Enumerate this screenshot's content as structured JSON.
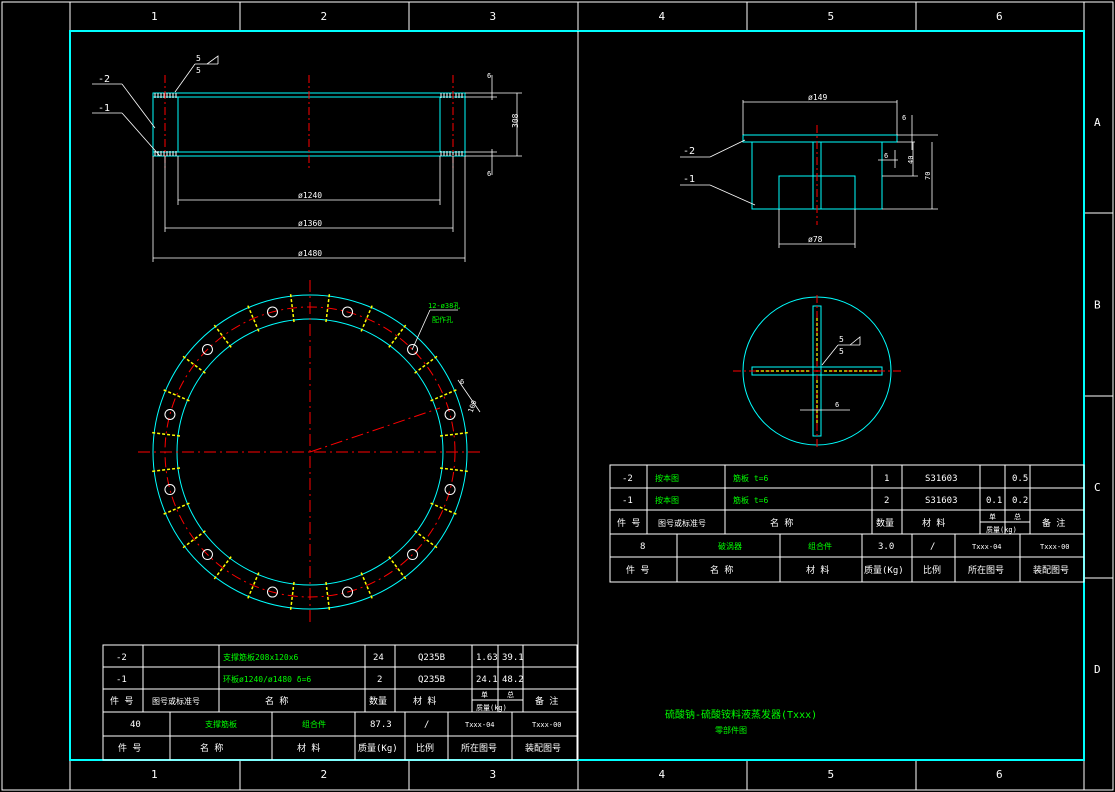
{
  "frame": {
    "col_labels": [
      "1",
      "2",
      "3",
      "4",
      "5",
      "6"
    ],
    "row_labels": [
      "A",
      "B",
      "C",
      "D"
    ]
  },
  "drawing_left": {
    "part_marks": [
      "-2",
      "-1"
    ],
    "weld_symbol": [
      "5",
      "5"
    ],
    "dims": {
      "d1240": "ø1240",
      "d1360": "ø1360",
      "d1480": "ø1480",
      "h308": "308",
      "t_top": "6",
      "t_bot": "6"
    },
    "hole_note": [
      "12-ø38孔",
      "配作孔"
    ],
    "rib_dims": [
      "6",
      "100"
    ]
  },
  "drawing_right": {
    "part_marks": [
      "-2",
      "-1"
    ],
    "dims": {
      "d149": "ø149",
      "d78": "ø78",
      "t6": "6",
      "h40": "40",
      "h70": "70",
      "t6b": "6"
    },
    "weld_symbol": [
      "5",
      "5"
    ],
    "rib_thk": "6"
  },
  "bom_left": {
    "rows": [
      {
        "no": "-2",
        "std": "",
        "name": "支撑筋板208x120x6",
        "qty": "24",
        "mat": "Q235B",
        "unit": "1.63",
        "total": "39.1",
        "note": ""
      },
      {
        "no": "-1",
        "std": "",
        "name": "环板ø1240/ø1480  δ=6",
        "qty": "2",
        "mat": "Q235B",
        "unit": "24.1",
        "total": "48.2",
        "note": ""
      }
    ],
    "header": {
      "no": "件 号",
      "std": "图号或标准号",
      "name": "名     称",
      "qty": "数量",
      "mat": "材    料",
      "unit1": "单",
      "unit2": "总",
      "mass": "质量(kg)",
      "note": "备  注"
    },
    "assembly": {
      "no": "40",
      "name": "支撑筋板",
      "mat": "组合件",
      "mass": "87.3",
      "scale": "/",
      "dwg": "Txxx-04",
      "asm": "Txxx-00"
    },
    "asm_header": {
      "no": "件  号",
      "name": "名    称",
      "mat": "材  料",
      "mass": "质量(Kg)",
      "scale": "比例",
      "dwg": "所在图号",
      "asm": "装配图号"
    }
  },
  "bom_right": {
    "rows": [
      {
        "no": "-2",
        "std": "按本图",
        "name": "筋板 t=6",
        "qty": "1",
        "mat": "S31603",
        "unit": "",
        "total": "0.5",
        "note": ""
      },
      {
        "no": "-1",
        "std": "按本图",
        "name": "筋板 t=6",
        "qty": "2",
        "mat": "S31603",
        "unit": "0.1",
        "total": "0.2",
        "note": ""
      }
    ],
    "header": {
      "no": "件  号",
      "std": "图号或标准号",
      "name": "名     称",
      "qty": "数量",
      "mat": "材    料",
      "unit1": "单",
      "unit2": "总",
      "mass": "质量(kg)",
      "note": "备  注"
    },
    "assembly": {
      "no": "8",
      "name": "破涡器",
      "mat": "组合件",
      "mass": "3.0",
      "scale": "/",
      "dwg": "Txxx-04",
      "asm": "Txxx-00"
    },
    "asm_header": {
      "no": "件  号",
      "name": "名    称",
      "mat": "材  料",
      "mass": "质量(Kg)",
      "scale": "比例",
      "dwg": "所在图号",
      "asm": "装配图号"
    }
  },
  "title": {
    "main": "硫酸钠-硫酸铵料液蒸发器(Txxx)",
    "sub": "零部件图"
  },
  "colors": {
    "frame": "#ffffff",
    "border": "#00ffff",
    "outline": "#00ffff",
    "center": "#ff0000",
    "text_green": "#00ff00",
    "text_white": "#ffffff",
    "weld": "#ffff00"
  }
}
